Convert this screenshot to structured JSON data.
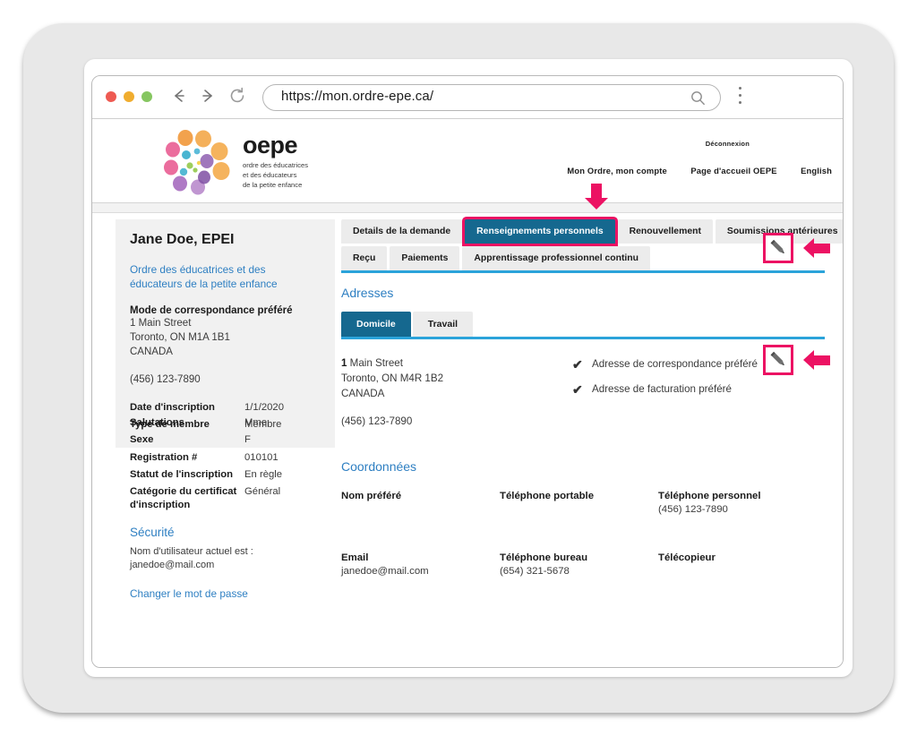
{
  "browser": {
    "url": "https://mon.ordre-epe.ca/",
    "back_icon": "back-arrow-icon",
    "forward_icon": "forward-arrow-icon",
    "reload_icon": "reload-icon",
    "search_icon": "search-icon",
    "menu_icon": "kebab-menu-icon"
  },
  "header": {
    "logo_word": "oepe",
    "logo_sub_line1": "ordre des éducatrices",
    "logo_sub_line2": "et des éducateurs",
    "logo_sub_line3": "de la petite enfance",
    "logout": "Déconnexion",
    "nav": [
      {
        "label": "Mon Ordre, mon compte"
      },
      {
        "label": "Page d'accueil OEPE"
      },
      {
        "label": "English"
      }
    ]
  },
  "sidebar": {
    "name": "Jane Doe, EPEI",
    "college_link": "Ordre des éducatrices et des éducateurs de la petite enfance",
    "correspondence_label": "Mode de correspondance préféré",
    "address_line1": "1 Main Street",
    "address_line2": "Toronto, ON  M1A 1B1",
    "address_line3": "CANADA",
    "phone": "(456) 123-7890",
    "rows_top": [
      {
        "key": "Date d'inscription",
        "value": "1/1/2020"
      },
      {
        "key": "Type de membre",
        "value": "Membre"
      }
    ],
    "rows_bottom": [
      {
        "key": "Salutations",
        "value": "Mme."
      },
      {
        "key": "Sexe",
        "value": "F"
      },
      {
        "key": "Registration #",
        "value": "010101"
      },
      {
        "key": "Statut de l'inscription",
        "value": "En règle"
      },
      {
        "key": "Catégorie du certificat d'inscription",
        "value": "Général"
      }
    ],
    "security_heading": "Sécurité",
    "username_line1": "Nom d'utilisateur actuel est :",
    "username_line2": "janedoe@mail.com",
    "change_password": "Changer le mot de passe"
  },
  "tabs": {
    "row1": [
      {
        "label": "Details de la demande",
        "active": false
      },
      {
        "label": "Renseignements personnels",
        "active": true
      },
      {
        "label": "Renouvellement",
        "active": false
      },
      {
        "label": "Soumissions antérieures",
        "active": false
      }
    ],
    "row2": [
      {
        "label": "Reçu",
        "active": false
      },
      {
        "label": "Paiements",
        "active": false
      },
      {
        "label": "Apprentissage professionnel continu",
        "active": false
      }
    ]
  },
  "addresses": {
    "heading": "Adresses",
    "subtabs": [
      {
        "label": "Domicile",
        "active": true
      },
      {
        "label": "Travail",
        "active": false
      }
    ],
    "street_number": "1",
    "street_name": " Main Street",
    "city_line": "Toronto, ON  M4R 1B2",
    "country": "CANADA",
    "phone": "(456) 123-7890",
    "flags": [
      {
        "checkmark": "✔",
        "label": "Adresse de correspondance préféré"
      },
      {
        "checkmark": "✔",
        "label": "Adresse de facturation préféré"
      }
    ]
  },
  "contact": {
    "heading": "Coordonnées",
    "row1": [
      {
        "label": "Nom préféré",
        "value": ""
      },
      {
        "label": "Téléphone portable",
        "value": ""
      },
      {
        "label": "Téléphone personnel",
        "value": "(456) 123-7890"
      }
    ],
    "row2": [
      {
        "label": "Email",
        "value": "janedoe@mail.com"
      },
      {
        "label": "Téléphone bureau",
        "value": "(654) 321-5678"
      },
      {
        "label": "Télécopieur",
        "value": ""
      }
    ]
  },
  "annotations": {
    "down_arrow": "down-arrow-annotation",
    "edit_pencil_1": "edit-pencil-icon",
    "edit_pencil_2": "edit-pencil-icon",
    "left_arrow_1": "left-arrow-annotation",
    "left_arrow_2": "left-arrow-annotation"
  },
  "colors": {
    "accent_pink": "#ec1263",
    "tab_active": "#15688f",
    "underline_blue": "#2ba3da",
    "link_blue": "#2e7fc2"
  }
}
